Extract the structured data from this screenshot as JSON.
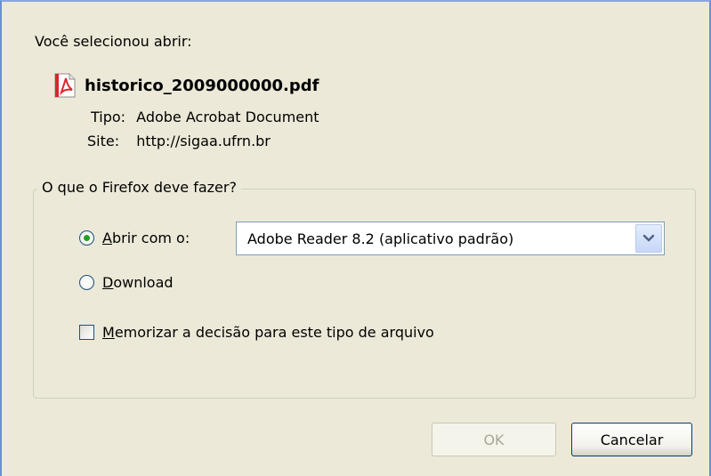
{
  "dialog": {
    "intro": "Você selecionou abrir:",
    "file_name": "historico_2009000000.pdf",
    "file_icon": "pdf-file-icon",
    "type_label": "Tipo:",
    "type_value": "Adobe Acrobat Document",
    "site_label": "Site:",
    "site_value": "http://sigaa.ufrn.br"
  },
  "action_group": {
    "legend": "O que o Firefox deve fazer?",
    "open_with": {
      "label": "Abrir com o:",
      "mnemonic": "A",
      "rest": "brir com o:",
      "selected": true
    },
    "application_select": {
      "value": "Adobe Reader 8.2 (aplicativo padrão)"
    },
    "download": {
      "label": "Download",
      "mnemonic": "D",
      "rest": "ownload",
      "selected": false
    },
    "remember": {
      "label": "Memorizar a decisão para este tipo de arquivo",
      "mnemonic": "M",
      "rest": "emorizar a decisão para este tipo de arquivo",
      "checked": false
    }
  },
  "buttons": {
    "ok": "OK",
    "ok_enabled": false,
    "cancel": "Cancelar"
  },
  "colors": {
    "dialog_background": "#ece9d8",
    "radio_selected": "#21a121",
    "control_border": "#1c5180",
    "select_border": "#7f9db9"
  }
}
